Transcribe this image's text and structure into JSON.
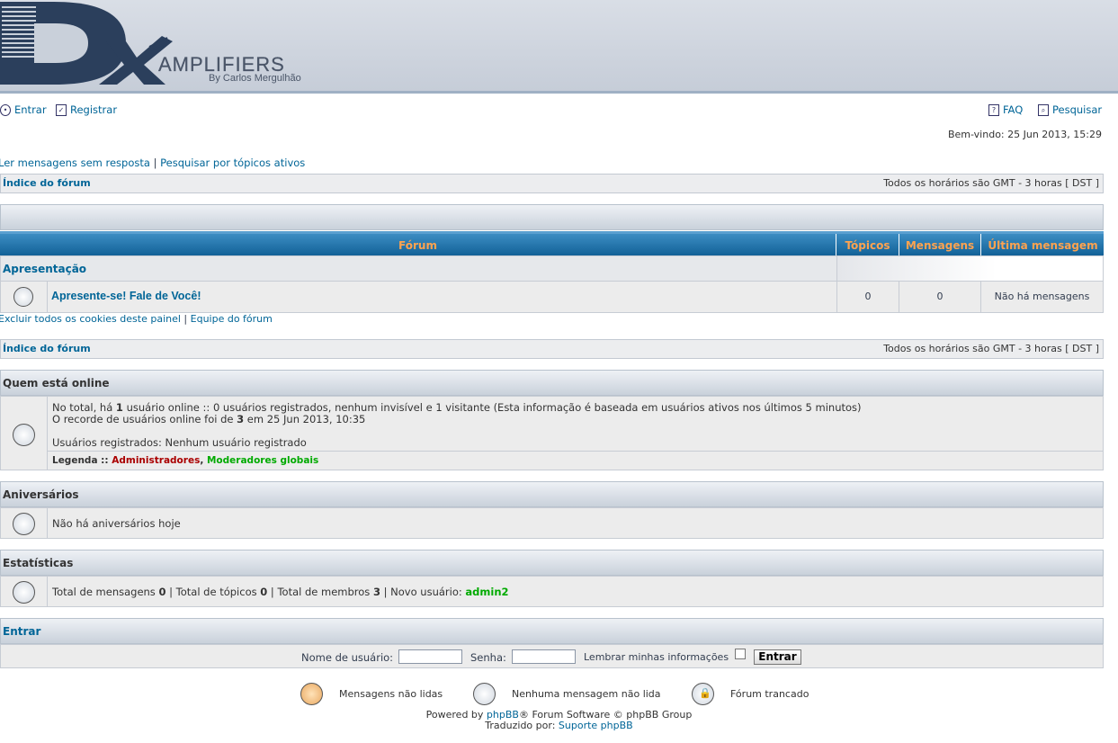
{
  "logo": {
    "brand_letters": "Dx",
    "brand_word": "AMPLIFIERS",
    "byline": "By Carlos Mergulhão"
  },
  "topmenu": {
    "login": "Entrar",
    "register": "Registrar",
    "faq": "FAQ",
    "search": "Pesquisar"
  },
  "welcome": "Bem-vindo: 25 Jun 2013, 15:29",
  "quicklinks": {
    "unanswered": "Ler mensagens sem resposta",
    "separator": "|",
    "active": "Pesquisar por tópicos ativos"
  },
  "navbar": {
    "index": "Índice do fórum",
    "timezone": "Todos os horários são GMT - 3 horas [ DST ]"
  },
  "forum_table": {
    "headers": [
      "Fórum",
      "Tópicos",
      "Mensagens",
      "Última mensagem"
    ],
    "category": "Apresentação",
    "rows": [
      {
        "name": "Apresente-se! Fale de Você!",
        "topics": "0",
        "posts": "0",
        "last": "Não há mensagens"
      }
    ]
  },
  "footer_links": {
    "cookies": "Excluir todos os cookies deste painel",
    "separator": "|",
    "team": "Equipe do fórum"
  },
  "who_online": {
    "title": "Quem está online",
    "line1_a": "No total, há ",
    "line1_count": "1",
    "line1_b": " usuário online :: 0 usuários registrados, nenhum invisível e 1 visitante (Esta informação é baseada em usuários ativos nos últimos 5 minutos)",
    "line2_a": "O recorde de usuários online foi de ",
    "line2_count": "3",
    "line2_b": " em 25 Jun 2013, 10:35",
    "line3": "Usuários registrados: Nenhum usuário registrado",
    "legend_label": "Legenda :: ",
    "legend_admins": "Administradores",
    "legend_comma": ", ",
    "legend_mods": "Moderadores globais"
  },
  "birthdays": {
    "title": "Aniversários",
    "text": "Não há aniversários hoje"
  },
  "stats": {
    "title": "Estatísticas",
    "a": "Total de mensagens ",
    "posts": "0",
    "b": " | Total de tópicos ",
    "topics": "0",
    "c": " | Total de membros ",
    "members": "3",
    "d": " | Novo usuário: ",
    "newest": "admin2"
  },
  "login_box": {
    "title": "Entrar",
    "username_label": "Nome de usuário:",
    "password_label": "Senha:",
    "remember_label": "Lembrar minhas informações",
    "submit": "Entrar"
  },
  "icon_legend": {
    "unread": "Mensagens não lidas",
    "no_unread": "Nenhuma mensagem não lida",
    "locked": "Fórum trancado"
  },
  "credits": {
    "powered_a": "Powered by ",
    "powered_link": "phpBB",
    "powered_b": "® Forum Software © phpBB Group",
    "translated_a": "Traduzido por: ",
    "translated_link": "Suporte phpBB"
  },
  "colors": {
    "link": "#006597",
    "header_blue": "#0d5c92",
    "header_text": "#ffa34f",
    "admin": "#aa0000",
    "moderator": "#00aa00",
    "newest_user": "#00aa00"
  }
}
